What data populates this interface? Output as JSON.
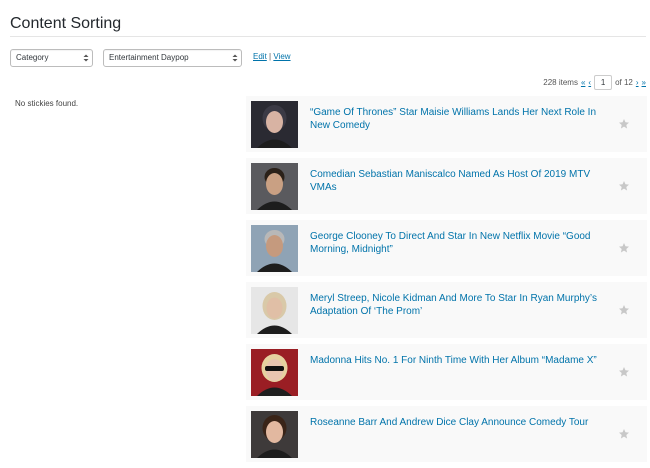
{
  "header": {
    "title": "Content Sorting"
  },
  "filters": {
    "category_label": "Category",
    "feed_label": "Entertainment Daypop",
    "edit_label": "Edit",
    "separator": "|",
    "view_label": "View"
  },
  "pagination": {
    "items_count": "228 items",
    "first_label": "«",
    "prev_label": "‹",
    "current_page": "1",
    "of_label": "of 12",
    "next_label": "›",
    "last_label": "»"
  },
  "stickies": {
    "empty_message": "No stickies found."
  },
  "articles": [
    {
      "title": "“Game Of Thrones” Star Maisie Williams Lands Her Next Role In New Comedy",
      "thumb_bg": "#2a2a32",
      "thumb_face": "#d8b3a3",
      "thumb_hair": "#3b3a45"
    },
    {
      "title": "Comedian Sebastian Maniscalco Named As Host Of 2019 MTV VMAs",
      "thumb_bg": "#5a5a5e",
      "thumb_face": "#c9a083",
      "thumb_hair": "#2b2119"
    },
    {
      "title": "George Clooney To Direct And Star In New Netflix Movie “Good Morning, Midnight”",
      "thumb_bg": "#8fa3b5",
      "thumb_face": "#c59a7e",
      "thumb_hair": "#b8b8b8"
    },
    {
      "title": "Meryl Streep, Nicole Kidman And More To Star In Ryan Murphy’s Adaptation Of ‘The Prom’",
      "thumb_bg": "#e6e6e6",
      "thumb_face": "#e0bfa6",
      "thumb_hair": "#d9c9a8"
    },
    {
      "title": "Madonna Hits No. 1 For Ninth Time With Her Album “Madame X”",
      "thumb_bg": "#9a1e24",
      "thumb_face": "#e8c4b0",
      "thumb_hair": "#e6d2a0"
    },
    {
      "title": "Roseanne Barr And Andrew Dice Clay Announce Comedy Tour",
      "thumb_bg": "#3e3a3a",
      "thumb_face": "#e2b8a0",
      "thumb_hair": "#3a2418"
    }
  ]
}
